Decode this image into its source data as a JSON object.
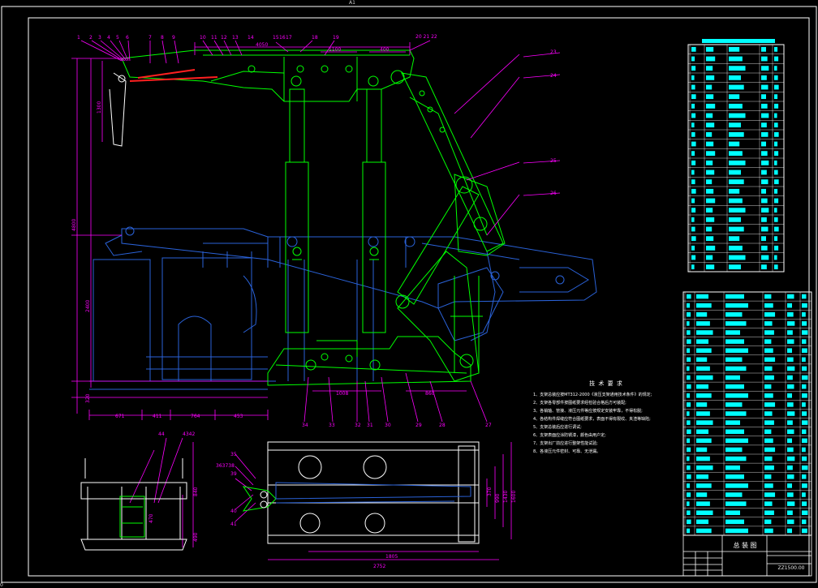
{
  "sheet": {
    "format": "A1",
    "title_block_name": "总 装 图",
    "drawing_number": "ZZ1500.00",
    "corner_mark": "0"
  },
  "colors": {
    "background": "#000000",
    "frame": "#ffffff",
    "support_raised": "#00ff00",
    "support_lowered": "#2a62d8",
    "dimensions": "#ff00ff",
    "table_text": "#00ffff",
    "hydraulic": "#ff2020"
  },
  "side_view": {
    "callouts_top": [
      "1",
      "2",
      "3",
      "4",
      "5",
      "6",
      "7",
      "8",
      "9",
      "10",
      "11",
      "12",
      "13",
      "14",
      "15",
      "16",
      "17",
      "18",
      "19",
      "20",
      "21",
      "22"
    ],
    "callouts_right": [
      "23",
      "24",
      "25",
      "26"
    ],
    "callouts_bottom": [
      "34",
      "33",
      "32",
      "31",
      "30",
      "29",
      "28",
      "27"
    ],
    "dimensions": {
      "top_span": "4050",
      "top_a": "1100",
      "top_b": "400",
      "canopy_drop": "1300",
      "max_height": "4800",
      "min_height": "2400",
      "base_height": "320",
      "base_seg1": "671",
      "base_seg2": "411",
      "base_seg3": "764",
      "base_seg4": "453",
      "pin_span": "1008",
      "rear_base": "860"
    },
    "top_right_callouts": "20 21 22"
  },
  "end_view": {
    "callouts": [
      "44",
      "43",
      "42"
    ],
    "dimensions": {
      "height": "840",
      "base": "490",
      "small": "470"
    }
  },
  "plan_view": {
    "callouts": [
      "35",
      "36",
      "37",
      "38",
      "39",
      "40",
      "41"
    ],
    "dimensions": {
      "length_a": "1805",
      "length_b": "2752",
      "width_a": "370",
      "width_b": "990",
      "width_c": "1430",
      "width_d": "1600"
    }
  },
  "notes": {
    "heading": "技 术 要 求",
    "items": [
      "1、支架总装应按MT312-2000《液压支架通用技术条件》的规定;",
      "2、支架各零部件按图纸要求经检验合格后方可装配;",
      "3、各销轴、管接、液压元件等应按规定安装牢靠，不得松脱;",
      "4、各结构件焊缝应符合图纸要求，表面不得有裂纹、夹渣等缺陷;",
      "5、支架总装后应进行调试;",
      "6、支架表面应涂防锈漆，颜色由用户定;",
      "7、支架出厂前应进行整架性能试验;",
      "8、各液压元件密封、可靠、无泄漏。"
    ]
  },
  "parts_list_upper_rows": 24,
  "parts_list_lower_rows": 27
}
